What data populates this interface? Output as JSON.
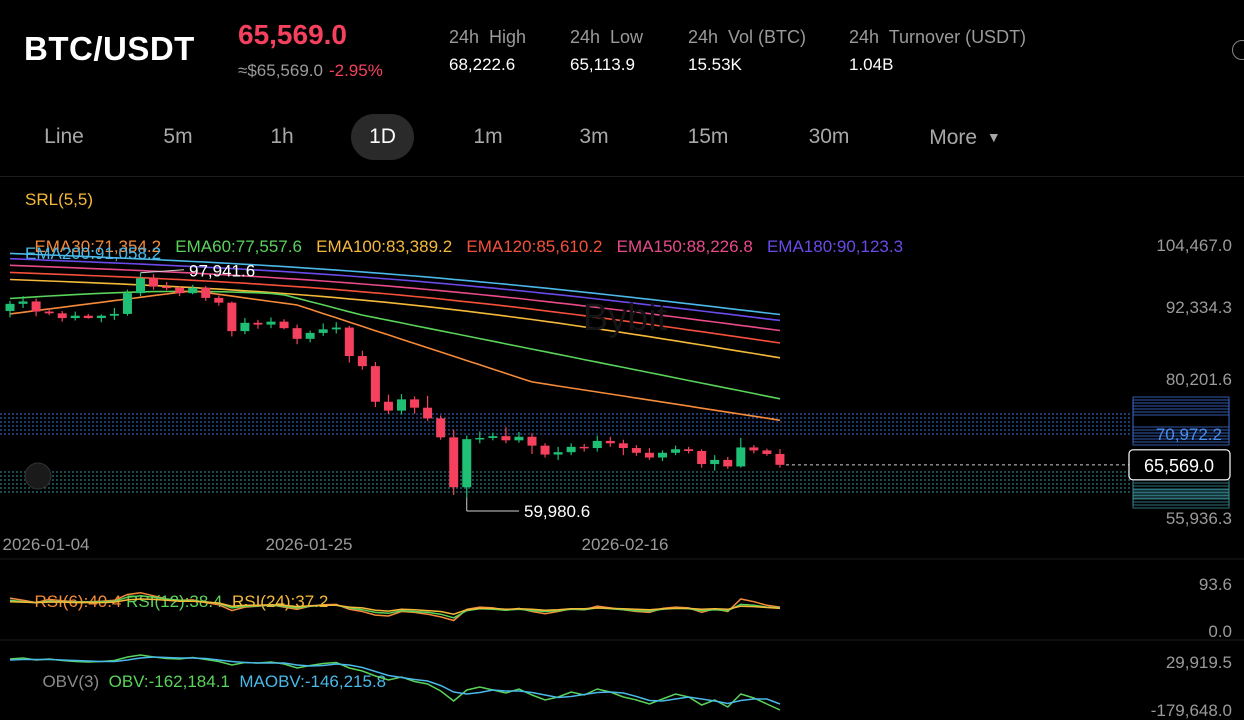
{
  "header": {
    "pair": "BTC/USDT",
    "last_price": "65,569.0",
    "ref_price": "≈$65,569.0",
    "change": "-2.95%",
    "stats": [
      {
        "label": "24h  High",
        "value": "68,222.6"
      },
      {
        "label": "24h  Low",
        "value": "65,113.9"
      },
      {
        "label": "24h  Vol (BTC)",
        "value": "15.53K"
      },
      {
        "label": "24h  Turnover (USDT)",
        "value": "1.04B"
      }
    ]
  },
  "timeframes": [
    "Line",
    "5m",
    "1h",
    "1D",
    "1m",
    "3m",
    "15m",
    "30m",
    "More"
  ],
  "active_timeframe": "1D",
  "indicators": {
    "srl": "SRL(5,5)",
    "ema": [
      {
        "text": "EMA30:71,354.2",
        "color": "#f58b3a"
      },
      {
        "text": "EMA60:77,557.6",
        "color": "#5ad35a"
      },
      {
        "text": "EMA100:83,389.2",
        "color": "#f5b93a"
      },
      {
        "text": "EMA120:85,610.2",
        "color": "#f5503a"
      },
      {
        "text": "EMA150:88,226.8",
        "color": "#e84a8a"
      },
      {
        "text": "EMA180:90,123.3",
        "color": "#6a4ae8"
      },
      {
        "text": "EMA200:91,058.2",
        "color": "#4ab8e8"
      }
    ],
    "rsi": [
      {
        "text": "RSI(6):40.4",
        "color": "#f58b3a"
      },
      {
        "text": "RSI(12):38.4",
        "color": "#5ad35a"
      },
      {
        "text": "RSI(24):37.2",
        "color": "#f5b93a"
      }
    ],
    "obv": [
      {
        "text": "OBV(3)",
        "color": "#8a8a8a"
      },
      {
        "text": "OBV:-162,184.1",
        "color": "#5ad35a"
      },
      {
        "text": "MAOBV:-146,215.8",
        "color": "#4ab8e8"
      }
    ]
  },
  "chart_data": [
    {
      "type": "candlestick",
      "x_labels": [
        "2026-01-04",
        "2026-01-25",
        "2026-02-16"
      ],
      "y_axis_labels": [
        "104,467.0",
        "92,334.3",
        "80,201.6",
        "70,972.2",
        "65,569.0",
        "55,936.3"
      ],
      "annotations": {
        "high": "97,941.6",
        "low": "59,980.6",
        "current": "65,569.0",
        "srl_level": "70,972.2"
      },
      "ylim": [
        55936.3,
        104467.0
      ],
      "candles": [
        [
          91500,
          93200,
          90400,
          92700
        ],
        [
          92700,
          94000,
          92000,
          93100
        ],
        [
          93100,
          93600,
          90600,
          91400
        ],
        [
          91400,
          91900,
          90800,
          91100
        ],
        [
          91100,
          91500,
          89700,
          90300
        ],
        [
          90300,
          91400,
          89900,
          90700
        ],
        [
          90700,
          91000,
          90200,
          90300
        ],
        [
          90300,
          90900,
          89600,
          90700
        ],
        [
          90700,
          92000,
          90000,
          91000
        ],
        [
          91000,
          95100,
          90700,
          94500
        ],
        [
          94500,
          97942,
          94000,
          97000
        ],
        [
          97000,
          97700,
          95100,
          95600
        ],
        [
          95600,
          96400,
          95000,
          95400
        ],
        [
          95400,
          95700,
          94000,
          94500
        ],
        [
          94500,
          95900,
          94300,
          95400
        ],
        [
          95400,
          95700,
          93200,
          93700
        ],
        [
          93700,
          94100,
          92400,
          92900
        ],
        [
          92900,
          93100,
          87200,
          88100
        ],
        [
          88100,
          90300,
          87600,
          89500
        ],
        [
          89500,
          90000,
          88500,
          89200
        ],
        [
          89200,
          90400,
          88600,
          89700
        ],
        [
          89700,
          90100,
          88400,
          88600
        ],
        [
          88600,
          89200,
          85900,
          86800
        ],
        [
          86800,
          88200,
          86200,
          87800
        ],
        [
          87800,
          89400,
          87300,
          88400
        ],
        [
          88400,
          89600,
          87700,
          88700
        ],
        [
          88700,
          89000,
          82800,
          83900
        ],
        [
          83900,
          84800,
          81600,
          82200
        ],
        [
          82200,
          82900,
          75300,
          76200
        ],
        [
          76200,
          77400,
          74100,
          74700
        ],
        [
          74700,
          77500,
          74000,
          76600
        ],
        [
          76600,
          77100,
          74200,
          75200
        ],
        [
          75200,
          77200,
          73000,
          73400
        ],
        [
          73400,
          73900,
          69800,
          70200
        ],
        [
          70200,
          71500,
          60500,
          61800
        ],
        [
          61800,
          70500,
          59981,
          69900
        ],
        [
          69900,
          71200,
          69200,
          70100
        ],
        [
          70100,
          71000,
          69700,
          70400
        ],
        [
          70400,
          71900,
          69200,
          69700
        ],
        [
          69700,
          71100,
          69300,
          70300
        ],
        [
          70300,
          70900,
          67400,
          68800
        ],
        [
          68800,
          69200,
          66800,
          67300
        ],
        [
          67300,
          68600,
          66400,
          67700
        ],
        [
          67700,
          69200,
          67200,
          68600
        ],
        [
          68600,
          69100,
          67800,
          68400
        ],
        [
          68400,
          70500,
          67800,
          69600
        ],
        [
          69600,
          70300,
          68600,
          69200
        ],
        [
          69200,
          69800,
          67200,
          68400
        ],
        [
          68400,
          68900,
          67100,
          67600
        ],
        [
          67600,
          68400,
          66400,
          66800
        ],
        [
          66800,
          68000,
          66200,
          67600
        ],
        [
          67600,
          68800,
          67200,
          68200
        ],
        [
          68200,
          68600,
          67500,
          67900
        ],
        [
          67900,
          68200,
          65100,
          65700
        ],
        [
          65700,
          67200,
          64600,
          66400
        ],
        [
          66400,
          66900,
          64900,
          65300
        ],
        [
          65300,
          70100,
          65100,
          68500
        ],
        [
          68500,
          68900,
          67500,
          68000
        ],
        [
          68000,
          68300,
          67100,
          67400
        ],
        [
          67400,
          68222,
          65114,
          65569
        ]
      ]
    },
    {
      "type": "line",
      "name": "RSI",
      "y_axis_labels": [
        "93.6",
        "0.0"
      ],
      "series": [
        {
          "name": "RSI(6)",
          "values": [
            60,
            55,
            50,
            57,
            54,
            52,
            52,
            53,
            55,
            68,
            72,
            65,
            58,
            55,
            56,
            50,
            45,
            32,
            40,
            42,
            45,
            40,
            35,
            42,
            45,
            46,
            35,
            30,
            22,
            20,
            30,
            28,
            24,
            18,
            10,
            35,
            40,
            38,
            33,
            37,
            30,
            25,
            30,
            36,
            34,
            42,
            38,
            34,
            30,
            28,
            37,
            40,
            38,
            28,
            36,
            30,
            58,
            52,
            44,
            40
          ]
        },
        {
          "name": "RSI(12)",
          "values": [
            55,
            52,
            50,
            53,
            52,
            51,
            51,
            52,
            53,
            62,
            65,
            62,
            58,
            55,
            54,
            52,
            48,
            38,
            42,
            43,
            44,
            42,
            38,
            42,
            44,
            44,
            38,
            34,
            28,
            26,
            32,
            30,
            28,
            24,
            16,
            32,
            36,
            35,
            33,
            35,
            32,
            30,
            32,
            35,
            34,
            38,
            36,
            34,
            32,
            31,
            35,
            37,
            36,
            32,
            34,
            32,
            46,
            44,
            40,
            38
          ]
        },
        {
          "name": "RSI(24)",
          "values": [
            52,
            51,
            50,
            51,
            51,
            50,
            50,
            50,
            51,
            56,
            58,
            57,
            55,
            53,
            53,
            51,
            49,
            42,
            44,
            44,
            45,
            44,
            41,
            43,
            44,
            44,
            40,
            38,
            33,
            31,
            35,
            34,
            32,
            30,
            24,
            34,
            37,
            37,
            35,
            36,
            35,
            33,
            34,
            36,
            36,
            38,
            37,
            36,
            35,
            34,
            36,
            37,
            37,
            35,
            36,
            35,
            42,
            41,
            39,
            37
          ]
        }
      ]
    },
    {
      "type": "line",
      "name": "OBV",
      "y_axis_labels": [
        "29,919.5",
        "-179,648.0"
      ],
      "series": [
        {
          "name": "OBV",
          "values": [
            10,
            12,
            8,
            10,
            7,
            5,
            4,
            5,
            7,
            14,
            18,
            14,
            11,
            10,
            13,
            9,
            5,
            -2,
            3,
            2,
            4,
            0,
            -8,
            -3,
            1,
            3,
            -8,
            -14,
            -24,
            -32,
            -26,
            -35,
            -40,
            -54,
            -74,
            -52,
            -46,
            -52,
            -58,
            -50,
            -62,
            -72,
            -66,
            -56,
            -62,
            -50,
            -56,
            -66,
            -72,
            -80,
            -70,
            -60,
            -66,
            -82,
            -72,
            -86,
            -60,
            -68,
            -80,
            -92
          ]
        },
        {
          "name": "MAOBV",
          "values": [
            8,
            9,
            9,
            9,
            8,
            7,
            6,
            5,
            5,
            8,
            12,
            14,
            13,
            12,
            12,
            11,
            8,
            5,
            3,
            2,
            2,
            2,
            -2,
            -4,
            -3,
            0,
            -2,
            -7,
            -15,
            -23,
            -27,
            -31,
            -34,
            -43,
            -56,
            -60,
            -57,
            -52,
            -54,
            -54,
            -57,
            -62,
            -67,
            -65,
            -61,
            -57,
            -56,
            -58,
            -65,
            -73,
            -74,
            -70,
            -66,
            -70,
            -74,
            -79,
            -73,
            -70,
            -70,
            -80
          ]
        }
      ]
    }
  ]
}
